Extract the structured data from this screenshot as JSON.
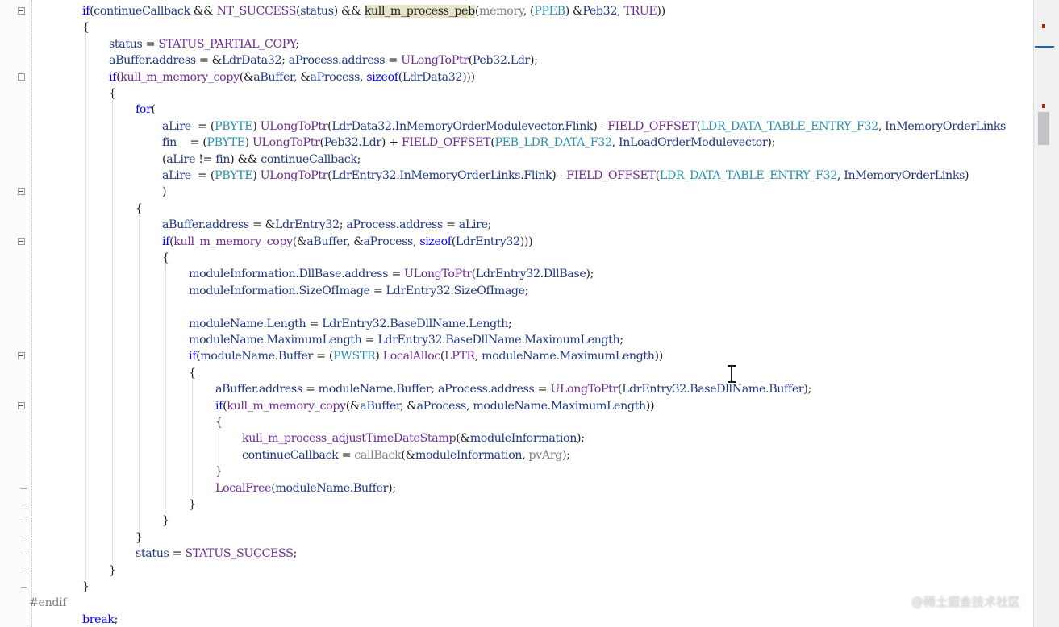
{
  "lines": [
    [
      [
        "k",
        "if"
      ],
      [
        "o",
        "("
      ],
      [
        "v",
        "continueCallback"
      ],
      [
        "o",
        " && "
      ],
      [
        "m",
        "NT_SUCCESS"
      ],
      [
        "o",
        "("
      ],
      [
        "v",
        "status"
      ],
      [
        "o",
        ") && "
      ],
      [
        "hl",
        "kull_m_process_peb"
      ],
      [
        "o",
        "("
      ],
      [
        "p",
        "memory"
      ],
      [
        "o",
        ", ("
      ],
      [
        "t",
        "PPEB"
      ],
      [
        "o",
        ") &"
      ],
      [
        "v",
        "Peb32"
      ],
      [
        "o",
        ", "
      ],
      [
        "m",
        "TRUE"
      ],
      [
        "o",
        "))"
      ]
    ],
    [
      [
        "o",
        "{"
      ]
    ],
    [
      [
        "v",
        "status"
      ],
      [
        "o",
        " = "
      ],
      [
        "m",
        "STATUS_PARTIAL_COPY"
      ],
      [
        "o",
        ";"
      ]
    ],
    [
      [
        "v",
        "aBuffer"
      ],
      [
        "o",
        "."
      ],
      [
        "v",
        "address"
      ],
      [
        "o",
        " = &"
      ],
      [
        "v",
        "LdrData32"
      ],
      [
        "o",
        "; "
      ],
      [
        "v",
        "aProcess"
      ],
      [
        "o",
        "."
      ],
      [
        "v",
        "address"
      ],
      [
        "o",
        " = "
      ],
      [
        "m",
        "ULongToPtr"
      ],
      [
        "o",
        "("
      ],
      [
        "v",
        "Peb32"
      ],
      [
        "o",
        "."
      ],
      [
        "v",
        "Ldr"
      ],
      [
        "o",
        ");"
      ]
    ],
    [
      [
        "k",
        "if"
      ],
      [
        "o",
        "("
      ],
      [
        "f",
        "kull_m_memory_copy"
      ],
      [
        "o",
        "(&"
      ],
      [
        "v",
        "aBuffer"
      ],
      [
        "o",
        ", &"
      ],
      [
        "v",
        "aProcess"
      ],
      [
        "o",
        ", "
      ],
      [
        "k",
        "sizeof"
      ],
      [
        "o",
        "("
      ],
      [
        "v",
        "LdrData32"
      ],
      [
        "o",
        ")))"
      ]
    ],
    [
      [
        "o",
        "{"
      ]
    ],
    [
      [
        "k",
        "for"
      ],
      [
        "o",
        "("
      ]
    ],
    [
      [
        "v",
        "aLire"
      ],
      [
        "o",
        "  = ("
      ],
      [
        "t",
        "PBYTE"
      ],
      [
        "o",
        ") "
      ],
      [
        "m",
        "ULongToPtr"
      ],
      [
        "o",
        "("
      ],
      [
        "v",
        "LdrData32"
      ],
      [
        "o",
        "."
      ],
      [
        "v",
        "InMemoryOrderModulevector"
      ],
      [
        "o",
        "."
      ],
      [
        "v",
        "Flink"
      ],
      [
        "o",
        ") - "
      ],
      [
        "m",
        "FIELD_OFFSET"
      ],
      [
        "o",
        "("
      ],
      [
        "t",
        "LDR_DATA_TABLE_ENTRY_F32"
      ],
      [
        "o",
        ", "
      ],
      [
        "v",
        "InMemoryOrderLinks"
      ]
    ],
    [
      [
        "v",
        "fin"
      ],
      [
        "o",
        "    = ("
      ],
      [
        "t",
        "PBYTE"
      ],
      [
        "o",
        ") "
      ],
      [
        "m",
        "ULongToPtr"
      ],
      [
        "o",
        "("
      ],
      [
        "v",
        "Peb32"
      ],
      [
        "o",
        "."
      ],
      [
        "v",
        "Ldr"
      ],
      [
        "o",
        ") + "
      ],
      [
        "m",
        "FIELD_OFFSET"
      ],
      [
        "o",
        "("
      ],
      [
        "t",
        "PEB_LDR_DATA_F32"
      ],
      [
        "o",
        ", "
      ],
      [
        "v",
        "InLoadOrderModulevector"
      ],
      [
        "o",
        ");"
      ]
    ],
    [
      [
        "o",
        "("
      ],
      [
        "v",
        "aLire"
      ],
      [
        "o",
        " != "
      ],
      [
        "v",
        "fin"
      ],
      [
        "o",
        ") && "
      ],
      [
        "v",
        "continueCallback"
      ],
      [
        "o",
        ";"
      ]
    ],
    [
      [
        "v",
        "aLire"
      ],
      [
        "o",
        "  = ("
      ],
      [
        "t",
        "PBYTE"
      ],
      [
        "o",
        ") "
      ],
      [
        "m",
        "ULongToPtr"
      ],
      [
        "o",
        "("
      ],
      [
        "v",
        "LdrEntry32"
      ],
      [
        "o",
        "."
      ],
      [
        "v",
        "InMemoryOrderLinks"
      ],
      [
        "o",
        "."
      ],
      [
        "v",
        "Flink"
      ],
      [
        "o",
        ") - "
      ],
      [
        "m",
        "FIELD_OFFSET"
      ],
      [
        "o",
        "("
      ],
      [
        "t",
        "LDR_DATA_TABLE_ENTRY_F32"
      ],
      [
        "o",
        ", "
      ],
      [
        "v",
        "InMemoryOrderLinks"
      ],
      [
        "o",
        ")"
      ]
    ],
    [
      [
        "o",
        ")"
      ]
    ],
    [
      [
        "o",
        "{"
      ]
    ],
    [
      [
        "v",
        "aBuffer"
      ],
      [
        "o",
        "."
      ],
      [
        "v",
        "address"
      ],
      [
        "o",
        " = &"
      ],
      [
        "v",
        "LdrEntry32"
      ],
      [
        "o",
        "; "
      ],
      [
        "v",
        "aProcess"
      ],
      [
        "o",
        "."
      ],
      [
        "v",
        "address"
      ],
      [
        "o",
        " = "
      ],
      [
        "v",
        "aLire"
      ],
      [
        "o",
        ";"
      ]
    ],
    [
      [
        "k",
        "if"
      ],
      [
        "o",
        "("
      ],
      [
        "f",
        "kull_m_memory_copy"
      ],
      [
        "o",
        "(&"
      ],
      [
        "v",
        "aBuffer"
      ],
      [
        "o",
        ", &"
      ],
      [
        "v",
        "aProcess"
      ],
      [
        "o",
        ", "
      ],
      [
        "k",
        "sizeof"
      ],
      [
        "o",
        "("
      ],
      [
        "v",
        "LdrEntry32"
      ],
      [
        "o",
        ")))"
      ]
    ],
    [
      [
        "o",
        "{"
      ]
    ],
    [
      [
        "v",
        "moduleInformation"
      ],
      [
        "o",
        "."
      ],
      [
        "v",
        "DllBase"
      ],
      [
        "o",
        "."
      ],
      [
        "v",
        "address"
      ],
      [
        "o",
        " = "
      ],
      [
        "m",
        "ULongToPtr"
      ],
      [
        "o",
        "("
      ],
      [
        "v",
        "LdrEntry32"
      ],
      [
        "o",
        "."
      ],
      [
        "v",
        "DllBase"
      ],
      [
        "o",
        ");"
      ]
    ],
    [
      [
        "v",
        "moduleInformation"
      ],
      [
        "o",
        "."
      ],
      [
        "v",
        "SizeOfImage"
      ],
      [
        "o",
        " = "
      ],
      [
        "v",
        "LdrEntry32"
      ],
      [
        "o",
        "."
      ],
      [
        "v",
        "SizeOfImage"
      ],
      [
        "o",
        ";"
      ]
    ],
    [],
    [
      [
        "v",
        "moduleName"
      ],
      [
        "o",
        "."
      ],
      [
        "v",
        "Length"
      ],
      [
        "o",
        " = "
      ],
      [
        "v",
        "LdrEntry32"
      ],
      [
        "o",
        "."
      ],
      [
        "v",
        "BaseDllName"
      ],
      [
        "o",
        "."
      ],
      [
        "v",
        "Length"
      ],
      [
        "o",
        ";"
      ]
    ],
    [
      [
        "v",
        "moduleName"
      ],
      [
        "o",
        "."
      ],
      [
        "v",
        "MaximumLength"
      ],
      [
        "o",
        " = "
      ],
      [
        "v",
        "LdrEntry32"
      ],
      [
        "o",
        "."
      ],
      [
        "v",
        "BaseDllName"
      ],
      [
        "o",
        "."
      ],
      [
        "v",
        "MaximumLength"
      ],
      [
        "o",
        ";"
      ]
    ],
    [
      [
        "k",
        "if"
      ],
      [
        "o",
        "("
      ],
      [
        "v",
        "moduleName"
      ],
      [
        "o",
        "."
      ],
      [
        "v",
        "Buffer"
      ],
      [
        "o",
        " = ("
      ],
      [
        "t",
        "PWSTR"
      ],
      [
        "o",
        ") "
      ],
      [
        "f",
        "LocalAlloc"
      ],
      [
        "o",
        "("
      ],
      [
        "m",
        "LPTR"
      ],
      [
        "o",
        ", "
      ],
      [
        "v",
        "moduleName"
      ],
      [
        "o",
        "."
      ],
      [
        "v",
        "MaximumLength"
      ],
      [
        "o",
        "))"
      ]
    ],
    [
      [
        "o",
        "{"
      ]
    ],
    [
      [
        "v",
        "aBuffer"
      ],
      [
        "o",
        "."
      ],
      [
        "v",
        "address"
      ],
      [
        "o",
        " = "
      ],
      [
        "v",
        "moduleName"
      ],
      [
        "o",
        "."
      ],
      [
        "v",
        "Buffer"
      ],
      [
        "o",
        "; "
      ],
      [
        "v",
        "aProcess"
      ],
      [
        "o",
        "."
      ],
      [
        "v",
        "address"
      ],
      [
        "o",
        " = "
      ],
      [
        "m",
        "ULongToPtr"
      ],
      [
        "o",
        "("
      ],
      [
        "v",
        "LdrEntry32"
      ],
      [
        "o",
        "."
      ],
      [
        "v",
        "BaseDllName"
      ],
      [
        "o",
        "."
      ],
      [
        "v",
        "Buffer"
      ],
      [
        "o",
        ");"
      ]
    ],
    [
      [
        "k",
        "if"
      ],
      [
        "o",
        "("
      ],
      [
        "f",
        "kull_m_memory_copy"
      ],
      [
        "o",
        "(&"
      ],
      [
        "v",
        "aBuffer"
      ],
      [
        "o",
        ", &"
      ],
      [
        "v",
        "aProcess"
      ],
      [
        "o",
        ", "
      ],
      [
        "v",
        "moduleName"
      ],
      [
        "o",
        "."
      ],
      [
        "v",
        "MaximumLength"
      ],
      [
        "o",
        "))"
      ]
    ],
    [
      [
        "o",
        "{"
      ]
    ],
    [
      [
        "f",
        "kull_m_process_adjustTimeDateStamp"
      ],
      [
        "o",
        "(&"
      ],
      [
        "v",
        "moduleInformation"
      ],
      [
        "o",
        ");"
      ]
    ],
    [
      [
        "v",
        "continueCallback"
      ],
      [
        "o",
        " = "
      ],
      [
        "p",
        "callBack"
      ],
      [
        "o",
        "(&"
      ],
      [
        "v",
        "moduleInformation"
      ],
      [
        "o",
        ", "
      ],
      [
        "p",
        "pvArg"
      ],
      [
        "o",
        ");"
      ]
    ],
    [
      [
        "o",
        "}"
      ]
    ],
    [
      [
        "f",
        "LocalFree"
      ],
      [
        "o",
        "("
      ],
      [
        "v",
        "moduleName"
      ],
      [
        "o",
        "."
      ],
      [
        "v",
        "Buffer"
      ],
      [
        "o",
        ");"
      ]
    ],
    [
      [
        "o",
        "}"
      ]
    ],
    [
      [
        "o",
        "}"
      ]
    ],
    [
      [
        "o",
        "}"
      ]
    ],
    [
      [
        "v",
        "status"
      ],
      [
        "o",
        " = "
      ],
      [
        "m",
        "STATUS_SUCCESS"
      ],
      [
        "o",
        ";"
      ]
    ],
    [
      [
        "o",
        "}"
      ]
    ],
    [
      [
        "o",
        "}"
      ]
    ],
    [
      [
        "d",
        "#endif"
      ]
    ],
    [
      [
        "k",
        "break"
      ],
      [
        "o",
        ";"
      ]
    ]
  ],
  "colors": {
    "keyword": "#0000ff",
    "function": "#6f2c91",
    "macro": "#6f2c91",
    "type": "#2b91af",
    "variable": "#1f377f",
    "parameter": "#808080",
    "directive": "#808080",
    "highlight_bg": "#e7e5c9",
    "error_marker": "#a1260d",
    "scroll_position": "#1e5fb4"
  },
  "watermark": "@稀土掘金技术社区"
}
